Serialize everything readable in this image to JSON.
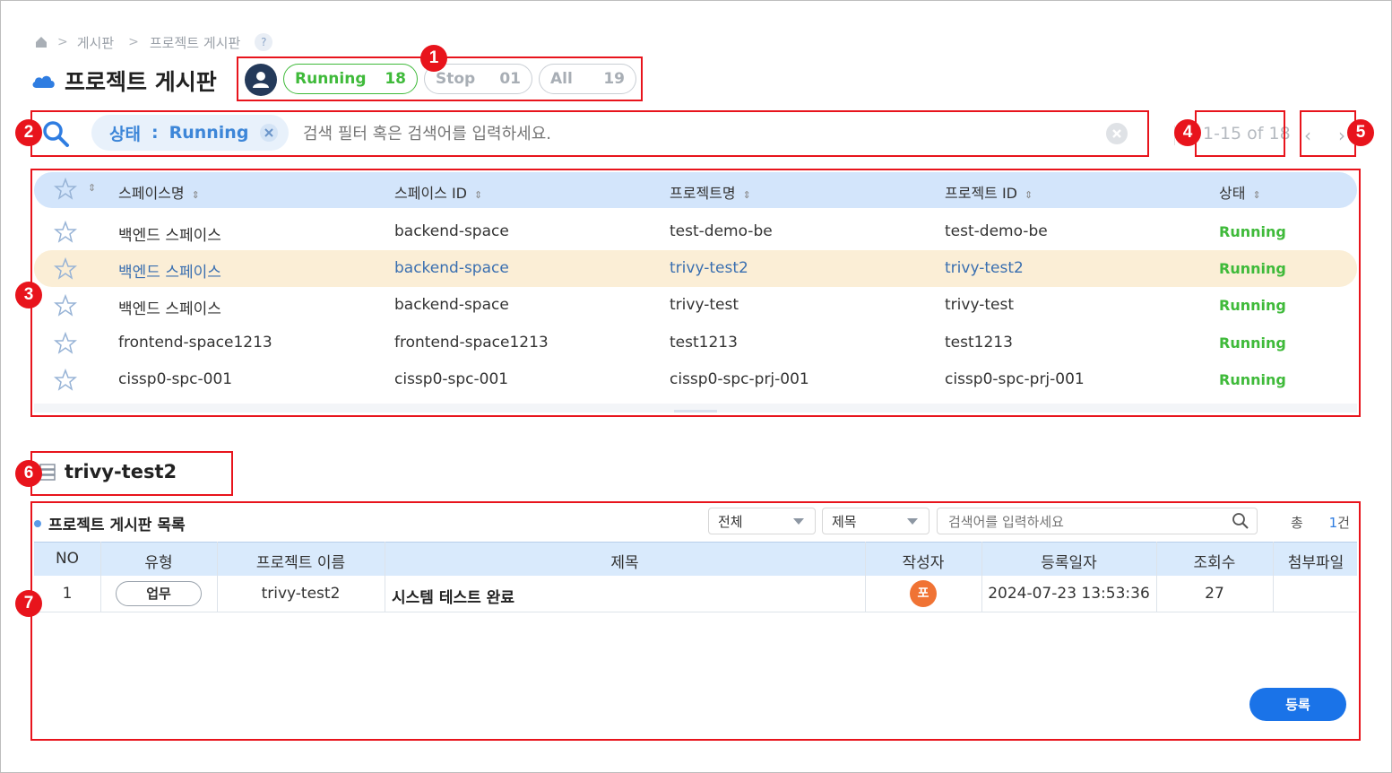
{
  "breadcrumb": {
    "home_icon": "home-icon",
    "items": [
      "게시판",
      "프로젝트 게시판"
    ],
    "help": "?"
  },
  "page_title": "프로젝트 게시판",
  "status_filters": {
    "running": {
      "label": "Running",
      "count": "18"
    },
    "stop": {
      "label": "Stop",
      "count": "01"
    },
    "all": {
      "label": "All",
      "count": "19"
    }
  },
  "search": {
    "chip_key": "상태",
    "chip_sep": ":",
    "chip_value": "Running",
    "placeholder": "검색 필터 혹은 검색어를 입력하세요."
  },
  "pagination": {
    "range": "1-15 of 18"
  },
  "table": {
    "headers": [
      "스페이스명",
      "스페이스 ID",
      "프로젝트명",
      "프로젝트 ID",
      "상태"
    ],
    "rows": [
      [
        "백엔드 스페이스",
        "backend-space",
        "test-demo-be",
        "test-demo-be",
        "Running"
      ],
      [
        "백엔드 스페이스",
        "backend-space",
        "trivy-test2",
        "trivy-test2",
        "Running"
      ],
      [
        "백엔드 스페이스",
        "backend-space",
        "trivy-test",
        "trivy-test",
        "Running"
      ],
      [
        "frontend-space1213",
        "frontend-space1213",
        "test1213",
        "test1213",
        "Running"
      ],
      [
        "cissp0-spc-001",
        "cissp0-spc-001",
        "cissp0-spc-prj-001",
        "cissp0-spc-prj-001",
        "Running"
      ]
    ],
    "selected_row": 1
  },
  "project_detail": {
    "name": "trivy-test2"
  },
  "board": {
    "title": "프로젝트 게시판 목록",
    "filter1": "전체",
    "filter2": "제목",
    "search_placeholder": "검색어를 입력하세요",
    "total_label": "총",
    "total_count": "1",
    "total_unit": "건",
    "headers": [
      "NO",
      "유형",
      "프로젝트 이름",
      "제목",
      "작성자",
      "등록일자",
      "조회수",
      "첨부파일"
    ],
    "rows": [
      {
        "no": "1",
        "type": "업무",
        "project": "trivy-test2",
        "title": "시스템 테스트 완료",
        "author": "포",
        "date": "2024-07-23 13:53:36",
        "views": "27",
        "attach": ""
      }
    ],
    "register": "등록"
  },
  "annotations": [
    "1",
    "2",
    "3",
    "4",
    "5",
    "6",
    "7"
  ],
  "colors": {
    "accent": "#1a73e8",
    "running": "#3fba3a",
    "annotation": "#e8141c",
    "selected_row": "#fbeed6",
    "header_bg": "#d3e5fb"
  }
}
